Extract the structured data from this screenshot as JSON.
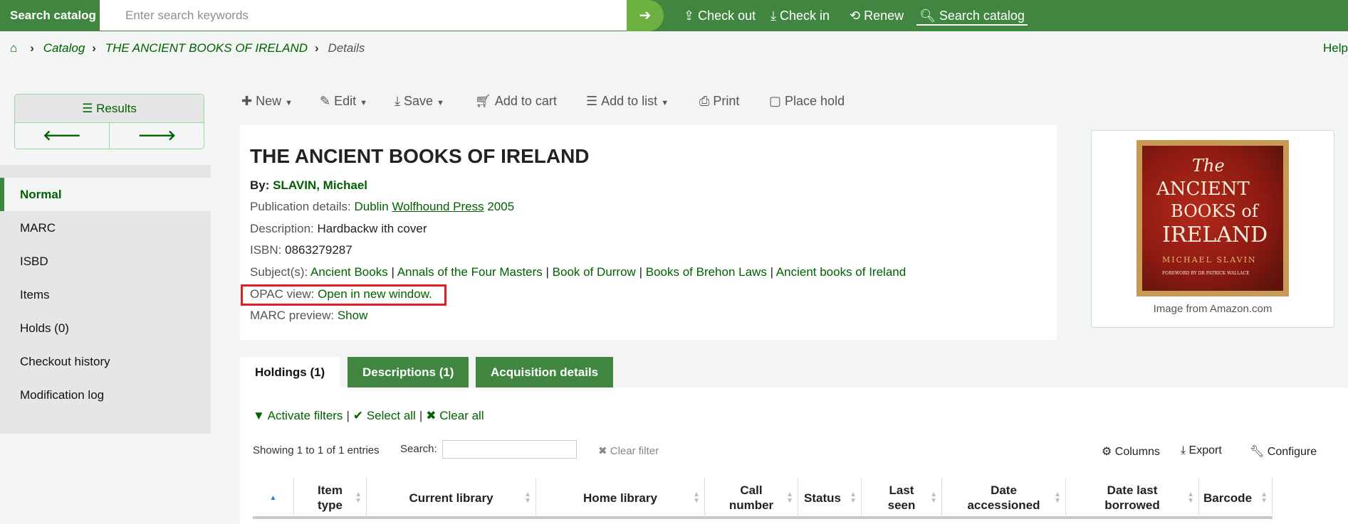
{
  "header": {
    "search_label": "Search catalog",
    "search_placeholder": "Enter search keywords",
    "links": [
      "Check out",
      "Check in",
      "Renew",
      "Search catalog"
    ]
  },
  "breadcrumb": [
    "Catalog",
    "THE ANCIENT BOOKS OF IRELAND",
    "Details"
  ],
  "help": "Help",
  "results": {
    "label": "Results"
  },
  "sidebar": [
    "Normal",
    "MARC",
    "ISBD",
    "Items",
    "Holds (0)",
    "Checkout history",
    "Modification log"
  ],
  "toolbar": [
    "New",
    "Edit",
    "Save",
    "Add to cart",
    "Add to list",
    "Print",
    "Place hold"
  ],
  "record": {
    "title": "THE ANCIENT BOOKS OF IRELAND",
    "by_label": "By:",
    "author": "SLAVIN, Michael",
    "pub_label": "Publication details:",
    "pub_place": "Dublin",
    "publisher": "Wolfhound Press",
    "pub_year": "2005",
    "desc_label": "Description:",
    "description": "Hardbackw ith cover",
    "isbn_label": "ISBN:",
    "isbn": "0863279287",
    "subj_label": "Subject(s):",
    "subjects": [
      "Ancient Books",
      "Annals of the Four Masters",
      "Book of Durrow",
      "Books of Brehon Laws",
      "Ancient books of Ireland"
    ],
    "opac_label": "OPAC view:",
    "opac_link": "Open in new window.",
    "marc_label": "MARC preview:",
    "marc_link": "Show"
  },
  "cover": {
    "line1": "The",
    "line2": "ANCIENT",
    "line3": "BOOKS of",
    "line4": "IRELAND",
    "author": "MICHAEL SLAVIN",
    "foreword": "FOREWORD BY DR PATRICK WALLACE",
    "caption": "Image from Amazon.com"
  },
  "tabs": [
    "Holdings (1)",
    "Descriptions (1)",
    "Acquisition details"
  ],
  "holdings": {
    "filters": [
      "Activate filters",
      "Select all",
      "Clear all"
    ],
    "showing": "Showing 1 to 1 of 1 entries",
    "search_label": "Search:",
    "clear_filter": "Clear filter",
    "tools": [
      "Columns",
      "Export",
      "Configure"
    ],
    "columns": [
      "Item type",
      "Current library",
      "Home library",
      "Call number",
      "Status",
      "Last seen",
      "Date accessioned",
      "Date last borrowed",
      "Barcode"
    ]
  },
  "colors": {
    "brand": "#408540",
    "link": "#006100",
    "highlight": "#e31b23"
  }
}
